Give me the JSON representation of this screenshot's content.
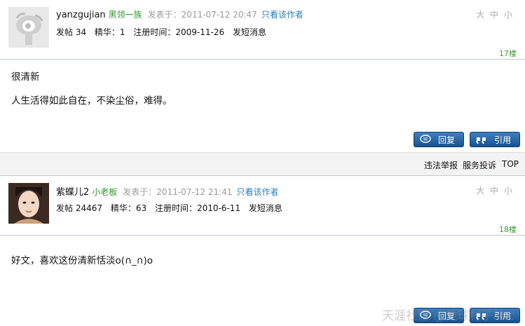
{
  "posts": [
    {
      "username": "yanzgujian",
      "rank": "黑领一族",
      "posted_at": "发表于：2011-07-12 20:47",
      "only_author": "只看该作者",
      "font_size": "大 中 小",
      "stats": {
        "posts": "发帖 34",
        "digest": "精华：1",
        "registered": "注册时间：2009-11-26",
        "message": "发短消息"
      },
      "floor": "17楼",
      "content": [
        "很清新",
        "人生活得如此自在，不染尘俗，难得。"
      ],
      "reply_label": "回复",
      "quote_label": "引用"
    },
    {
      "username": "紫蝶儿2",
      "rank": "小老板",
      "posted_at": "发表于：2011-07-12 21:41",
      "only_author": "只看该作者",
      "font_size": "大 中 小",
      "stats": {
        "posts": "发帖 24467",
        "digest": "精华：63",
        "registered": "注册时间：2010-6-11",
        "message": "发短消息"
      },
      "floor": "18楼",
      "content": [
        "好文，喜欢这份清新恬淡o(∩_∩)o"
      ],
      "reply_label": "回复",
      "quote_label": "引用"
    }
  ],
  "toolbar": {
    "report": "违法举报",
    "complaint": "服务投诉",
    "top": "TOP"
  },
  "watermark": "天涯社区 @地球村子abc",
  "colors": {
    "button": "#2a67a6",
    "rank": "#2c9a2c",
    "link": "#2a7fb8",
    "divider": "#b5cbe0"
  }
}
